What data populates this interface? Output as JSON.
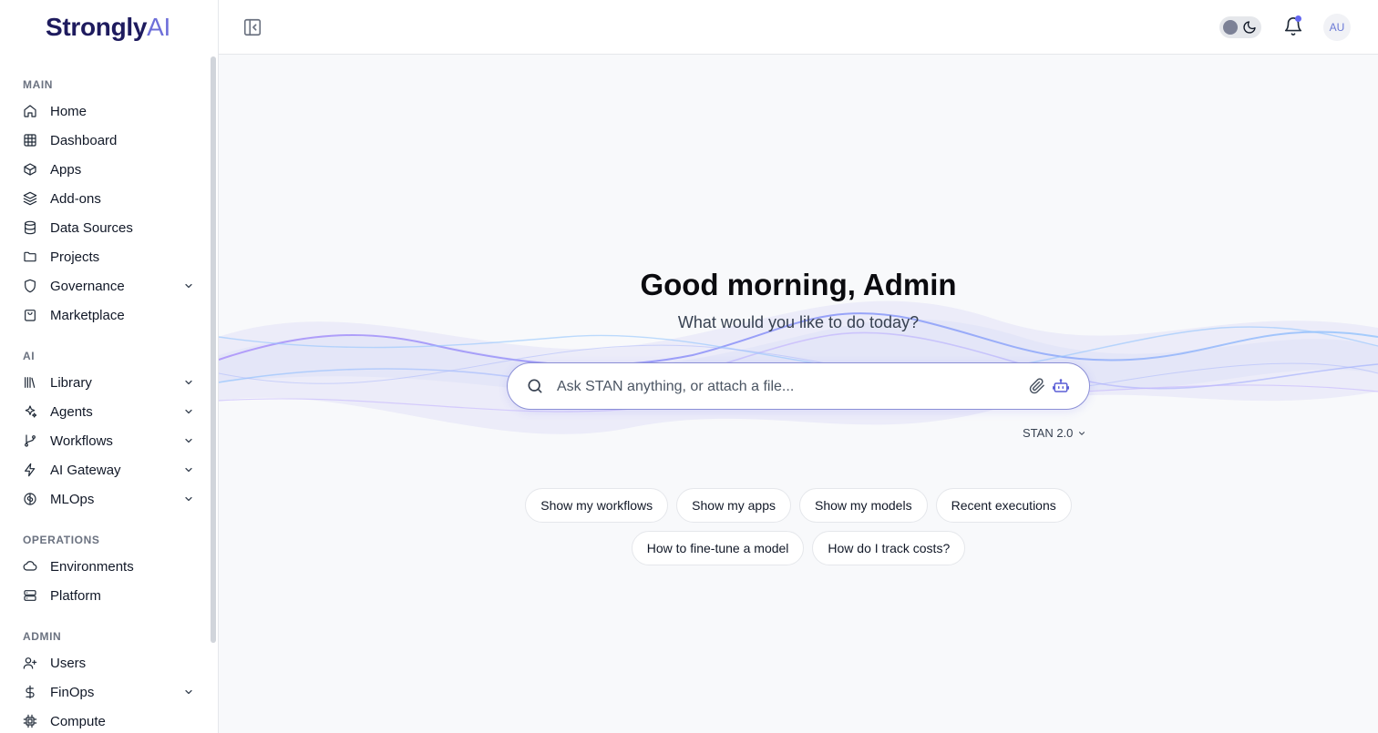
{
  "brand": {
    "name": "Strongly",
    "suffix": "AI"
  },
  "sidebar": {
    "sections": [
      {
        "label": "MAIN",
        "items": [
          {
            "label": "Home",
            "icon": "home-icon",
            "expandable": false
          },
          {
            "label": "Dashboard",
            "icon": "grid-icon",
            "expandable": false
          },
          {
            "label": "Apps",
            "icon": "box-icon",
            "expandable": false
          },
          {
            "label": "Add-ons",
            "icon": "layers-icon",
            "expandable": false
          },
          {
            "label": "Data Sources",
            "icon": "database-icon",
            "expandable": false
          },
          {
            "label": "Projects",
            "icon": "folder-icon",
            "expandable": false
          },
          {
            "label": "Governance",
            "icon": "shield-icon",
            "expandable": true
          },
          {
            "label": "Marketplace",
            "icon": "store-icon",
            "expandable": false
          }
        ]
      },
      {
        "label": "AI",
        "items": [
          {
            "label": "Library",
            "icon": "library-icon",
            "expandable": true
          },
          {
            "label": "Agents",
            "icon": "sparkles-icon",
            "expandable": true
          },
          {
            "label": "Workflows",
            "icon": "git-branch-icon",
            "expandable": true
          },
          {
            "label": "AI Gateway",
            "icon": "zap-icon",
            "expandable": true
          },
          {
            "label": "MLOps",
            "icon": "brain-icon",
            "expandable": true
          }
        ]
      },
      {
        "label": "OPERATIONS",
        "items": [
          {
            "label": "Environments",
            "icon": "cloud-icon",
            "expandable": false
          },
          {
            "label": "Platform",
            "icon": "server-icon",
            "expandable": false
          }
        ]
      },
      {
        "label": "ADMIN",
        "items": [
          {
            "label": "Users",
            "icon": "user-plus-icon",
            "expandable": false
          },
          {
            "label": "FinOps",
            "icon": "dollar-icon",
            "expandable": true
          },
          {
            "label": "Compute",
            "icon": "cpu-icon",
            "expandable": false
          }
        ]
      }
    ]
  },
  "header": {
    "avatar_initials": "AU"
  },
  "main": {
    "greeting": "Good morning, Admin",
    "subtitle": "What would you like to do today?",
    "search_placeholder": "Ask STAN anything, or attach a file...",
    "model": "STAN 2.0",
    "suggestions_row1": [
      "Show my workflows",
      "Show my apps",
      "Show my models",
      "Recent executions"
    ],
    "suggestions_row2": [
      "How to fine-tune a model",
      "How do I track costs?"
    ]
  },
  "colors": {
    "accent": "#6366f1",
    "brand_dark": "#1e1b5e",
    "brand_light": "#6e6fd9"
  }
}
